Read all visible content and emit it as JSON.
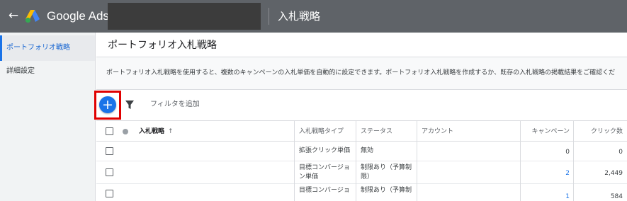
{
  "topbar": {
    "back_icon": "arrow-left-icon",
    "brand": "Google Ads",
    "page_title": "入札戦略"
  },
  "sidebar": {
    "items": [
      {
        "label": "ポートフォリオ戦略",
        "active": true
      },
      {
        "label": "詳細設定",
        "active": false
      }
    ]
  },
  "main": {
    "title": "ポートフォリオ入札戦略",
    "description": "ポートフォリオ入札戦略を使用すると、複数のキャンペーンの入札単価を自動的に設定できます。ポートフォリオ入札戦略を作成するか、既存の入札戦略の掲載結果をご確認くだ",
    "toolbar": {
      "add_button": "+",
      "filter_placeholder": "フィルタを追加"
    },
    "table": {
      "columns": {
        "name": "入札戦略",
        "sort_indicator": "↑",
        "type": "入札戦略タイプ",
        "status": "ステータス",
        "account": "アカウント",
        "campaigns": "キャンペーン",
        "clicks": "クリック数"
      },
      "rows": [
        {
          "name": "",
          "type": [
            "拡張クリック単価"
          ],
          "status": [
            "無効"
          ],
          "account": "",
          "campaigns": "0",
          "clicks": "0"
        },
        {
          "name": "",
          "type": [
            "目標コンバージョ",
            "ン単価"
          ],
          "status": [
            "制限あり（予算制",
            "限）"
          ],
          "account": "",
          "campaigns": "2",
          "clicks": "2,449"
        },
        {
          "name": "",
          "type": [
            "目標コンバージョ"
          ],
          "status": [
            "制限あり（予算制"
          ],
          "account": "",
          "campaigns": "1",
          "clicks": "584"
        }
      ]
    }
  },
  "colors": {
    "topbar": "#5f6368",
    "accent": "#1a73e8",
    "highlight": "#e00000"
  }
}
